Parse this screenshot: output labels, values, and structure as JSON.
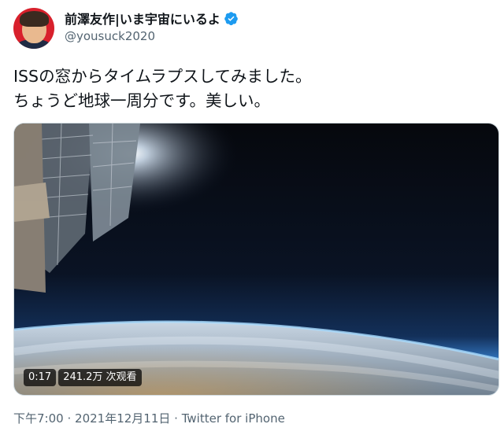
{
  "user": {
    "display_name": "前澤友作|いま宇宙にいるよ",
    "handle": "@yousuck2020",
    "verified_icon": "verified-badge-icon",
    "verified_color": "#1d9bf0"
  },
  "tweet": {
    "text_lines": [
      "ISSの窓からタイムラプスしてみました。",
      "ちょうど地球一周分です。美しい。"
    ]
  },
  "video": {
    "duration": "0:17",
    "views": "241.2万 次观看"
  },
  "meta": {
    "time": "下午7:00",
    "separator": "·",
    "date": "2021年12月11日",
    "source": "Twitter for iPhone"
  }
}
